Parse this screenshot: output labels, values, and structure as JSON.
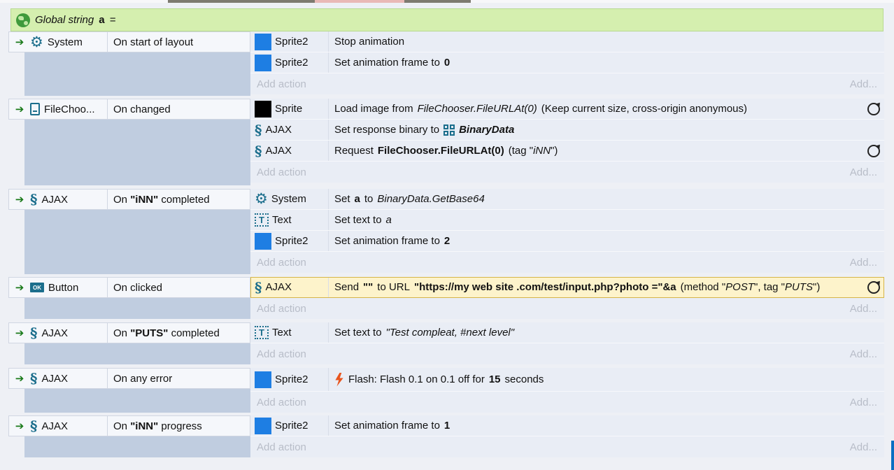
{
  "global_var": {
    "prefix": "Global string",
    "name": "a",
    "suffix": "="
  },
  "add_action_label": "Add action",
  "add_label": "Add...",
  "events": [
    {
      "object": "System",
      "icon": "gear-icon",
      "condition": "On start of layout",
      "actions": [
        {
          "object": "Sprite2",
          "icon": "sprite2-icon",
          "text": "Set animation frame to",
          "bold": "0",
          "pre": "Stop animation"
        }
      ]
    }
  ],
  "e1": {
    "object": "System",
    "condition": "On start of layout",
    "a1": {
      "object": "Sprite2",
      "text": "Stop animation"
    },
    "a2": {
      "object": "Sprite2",
      "text": "Set animation frame to",
      "bold": "0"
    }
  },
  "e2": {
    "object": "FileChoo...",
    "condition": "On changed",
    "a1": {
      "object": "Sprite",
      "t1": "Load image from",
      "i1": "FileChooser.FileURLAt(0)",
      "t2": "(Keep current size, cross-origin anonymous)"
    },
    "a2": {
      "object": "AJAX",
      "t1": "Set response binary to",
      "bold": "BinaryData"
    },
    "a3": {
      "object": "AJAX",
      "t1": "Request",
      "bold": "FileChooser.FileURLAt(0)",
      "t2": "(tag \"",
      "i1": "iNN",
      "t3": "\")"
    }
  },
  "e3": {
    "object": "AJAX",
    "c_pre": "On",
    "c_bold": "\"iNN\"",
    "c_post": "completed",
    "a1": {
      "object": "System",
      "t1": "Set",
      "bold": "a",
      "t2": "to",
      "i1": "BinaryData.GetBase64"
    },
    "a2": {
      "object": "Text",
      "t1": "Set text to",
      "i1": "a"
    },
    "a3": {
      "object": "Sprite2",
      "t1": "Set animation frame to",
      "bold": "2"
    }
  },
  "e4": {
    "object": "Button",
    "condition": "On clicked",
    "a1": {
      "object": "AJAX",
      "t1": "Send",
      "bold1": "\"\"",
      "t2": "to URL",
      "bold2": "\"https://my web site .com/test/input.php?photo =\"&a",
      "t3": "(method \"",
      "i1": "POST",
      "t4": "\", tag \"",
      "i2": "PUTS",
      "t5": "\")"
    }
  },
  "e5": {
    "object": "AJAX",
    "c_pre": "On",
    "c_bold": "\"PUTS\"",
    "c_post": "completed",
    "a1": {
      "object": "Text",
      "t1": "Set text to",
      "i1": "\"Test compleat, #next level\""
    }
  },
  "e6": {
    "object": "AJAX",
    "condition": "On any error",
    "a1": {
      "object": "Sprite2",
      "t1": "Flash: Flash 0.1 on 0.1 off for",
      "bold": "15",
      "t2": "seconds"
    }
  },
  "e7": {
    "object": "AJAX",
    "c_pre": "On",
    "c_bold": "\"iNN\"",
    "c_post": "progress",
    "a1": {
      "object": "Sprite2",
      "t1": "Set animation frame to",
      "bold": "1"
    }
  },
  "colors": {
    "global_bg": "#d5efaf",
    "highlight": "#fdf3cb",
    "sprite2": "#1e7ee3",
    "icon": "#1b6e8c"
  }
}
